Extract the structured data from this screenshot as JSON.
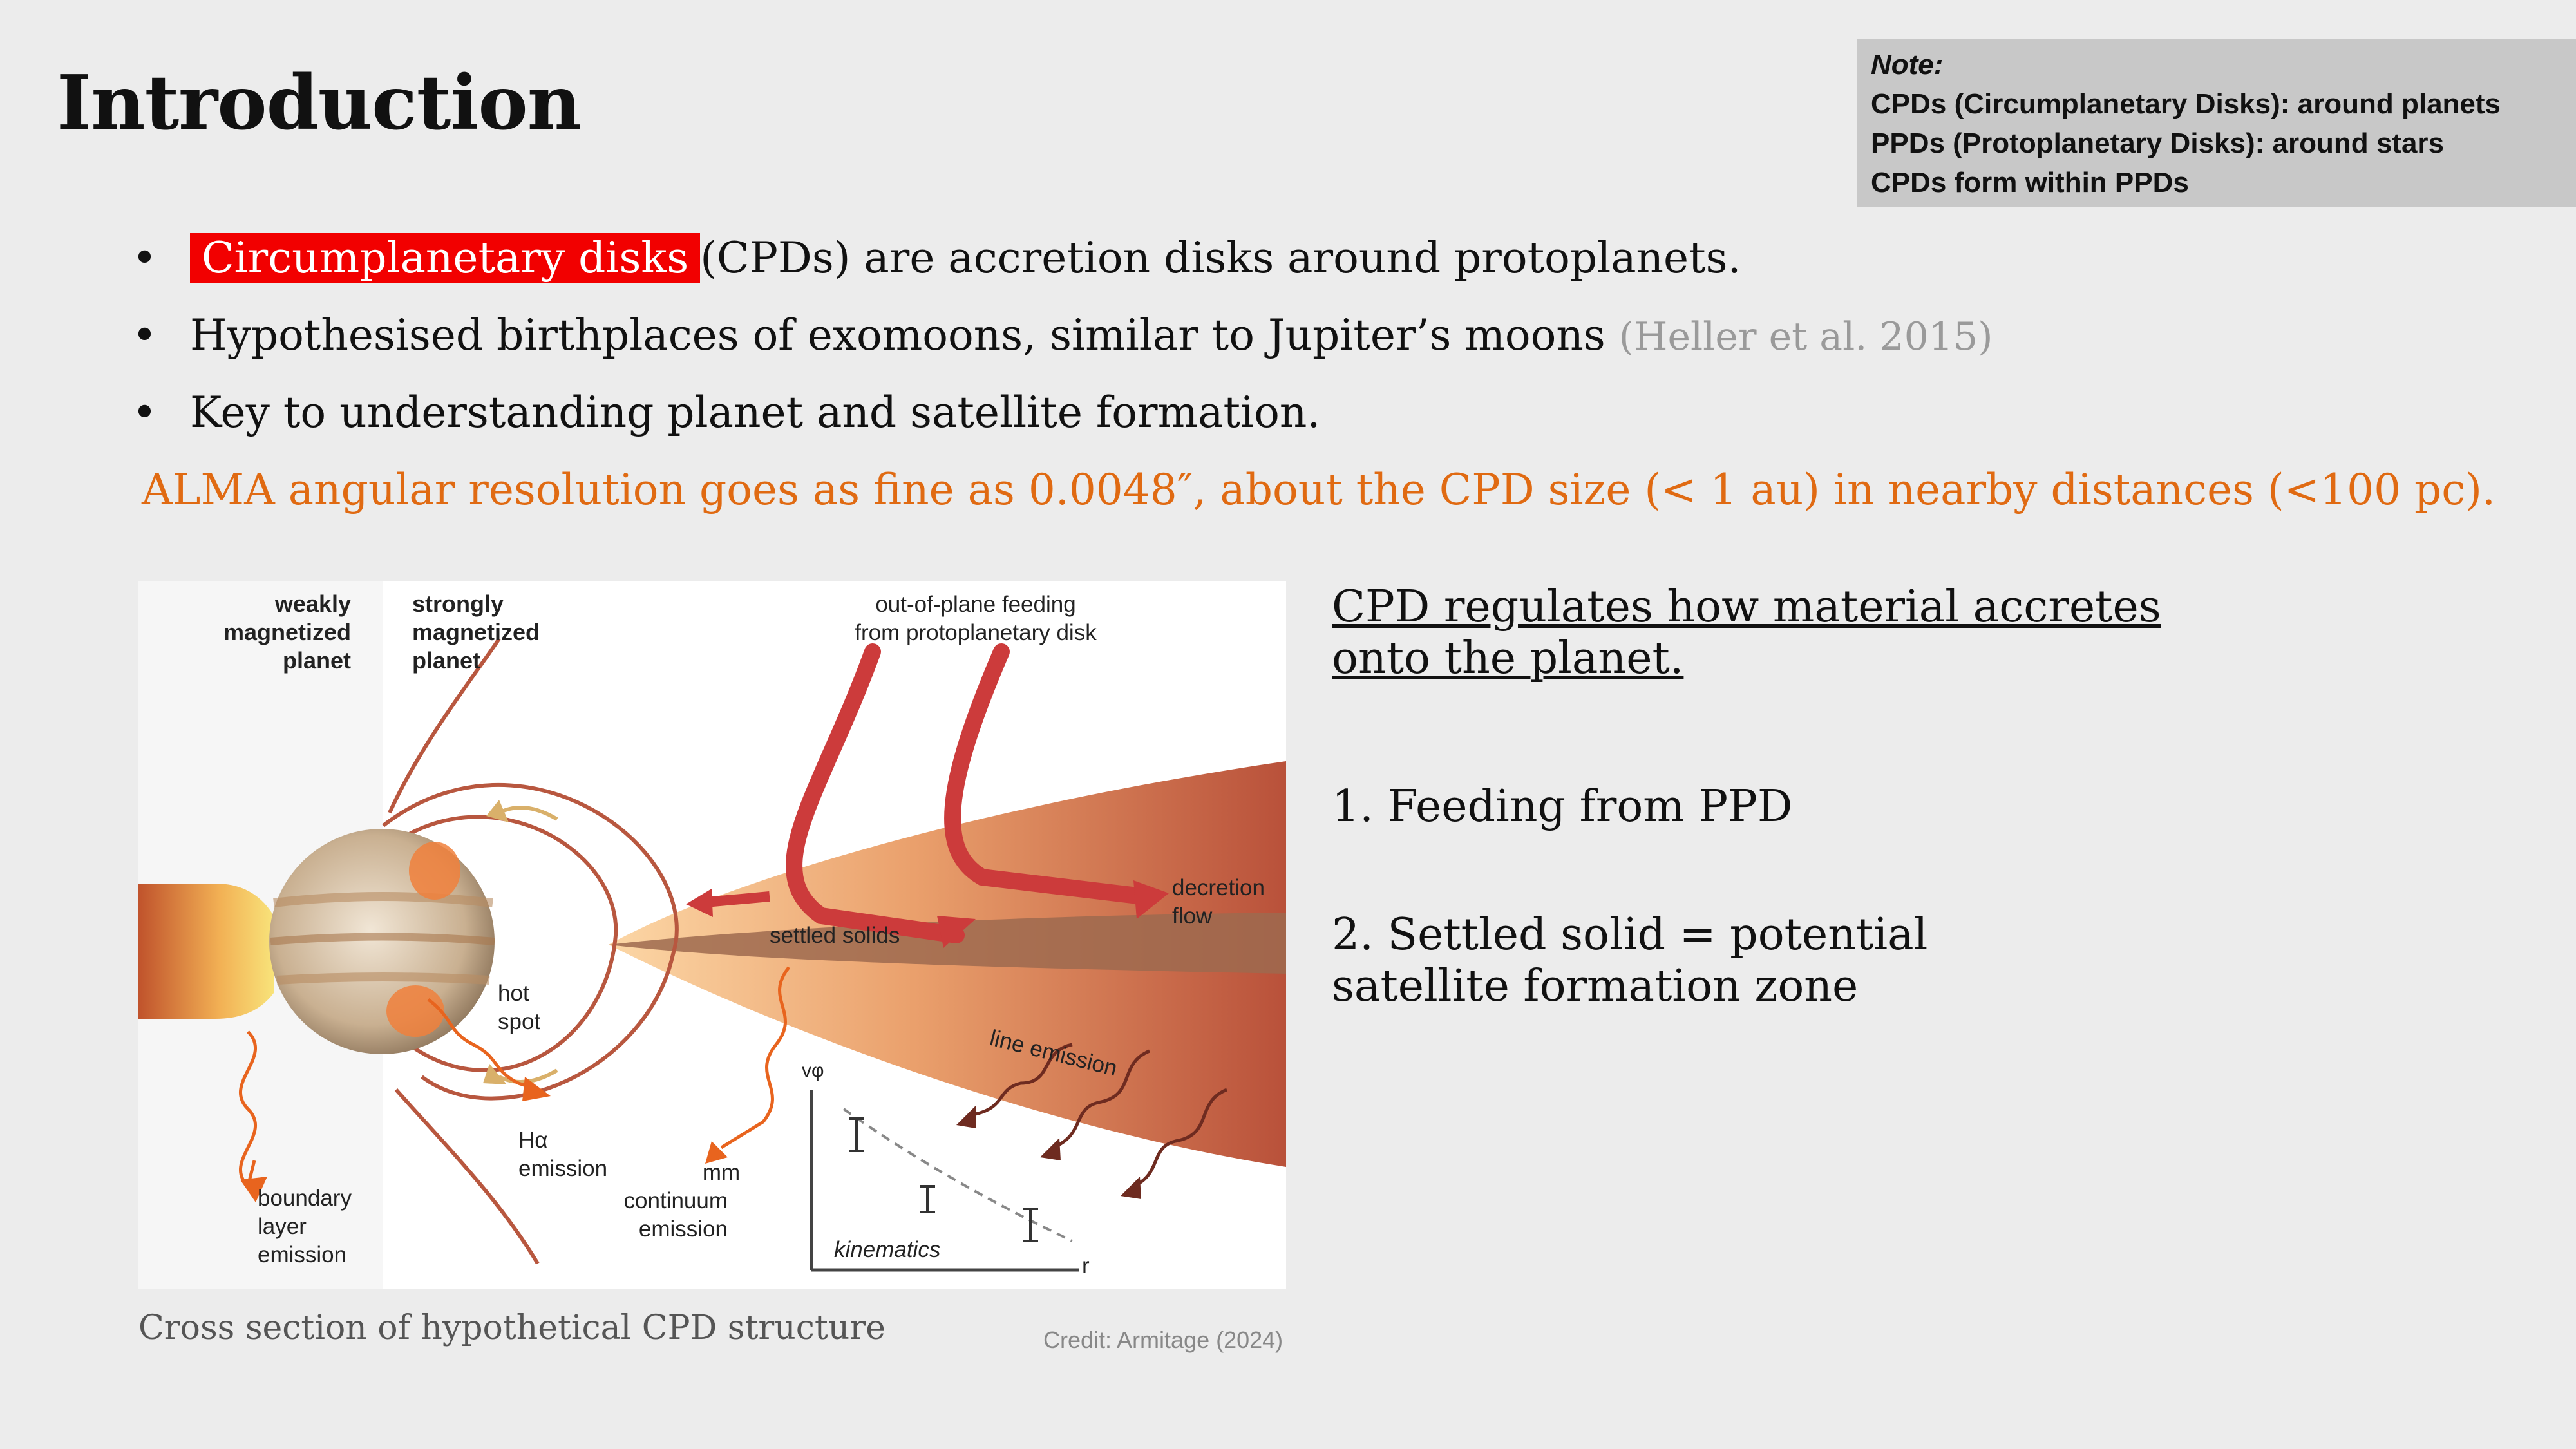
{
  "title": "Introduction",
  "note": {
    "heading": "Note:",
    "lines": [
      "CPDs (Circumplanetary Disks): around planets",
      "PPDs (Protoplanetary Disks): around stars",
      "CPDs form within PPDs"
    ]
  },
  "bullets": [
    {
      "marker": "•",
      "highlight": "Circumplanetary disks",
      "text": "(CPDs) are accretion disks around protoplanets."
    },
    {
      "marker": "•",
      "text": "Hypothesised birthplaces of exomoons, similar to Jupiter’s moons",
      "citation": "(Heller et al. 2015)"
    },
    {
      "marker": "•",
      "text": "Key to understanding planet and satellite formation."
    }
  ],
  "alma_note": "ALMA angular resolution goes as fine as 0.0048″, about the CPD size (< 1 au) in nearby distances (<100 pc).",
  "figure": {
    "labels": {
      "weakly": [
        "weakly",
        "magnetized",
        "planet"
      ],
      "strongly": [
        "strongly",
        "magnetized",
        "planet"
      ],
      "feeding": [
        "out-of-plane feeding",
        "from protoplanetary disk"
      ],
      "decretion": [
        "decretion",
        "flow"
      ],
      "settled": "settled solids",
      "hotspot": [
        "hot",
        "spot"
      ],
      "line_emission": "line emission",
      "halpha": [
        "Hα",
        "emission"
      ],
      "boundary": [
        "boundary",
        "layer",
        "emission"
      ],
      "mm": [
        "mm",
        "continuum",
        "emission"
      ],
      "v_axis": "vφ",
      "r_axis": "r",
      "kinematics": "kinematics"
    },
    "colors": {
      "disk": "#c0543a",
      "arrow": "#c83232",
      "planet": "#d8c2a0",
      "wavy": "#e8641e"
    }
  },
  "caption": "Cross section of hypothetical CPD structure",
  "credit": "Credit: Armitage (2024)",
  "regulates": "CPD regulates how material accretes onto the planet.",
  "points": [
    "1. Feeding from PPD",
    "2. Settled solid = potential satellite formation zone"
  ]
}
